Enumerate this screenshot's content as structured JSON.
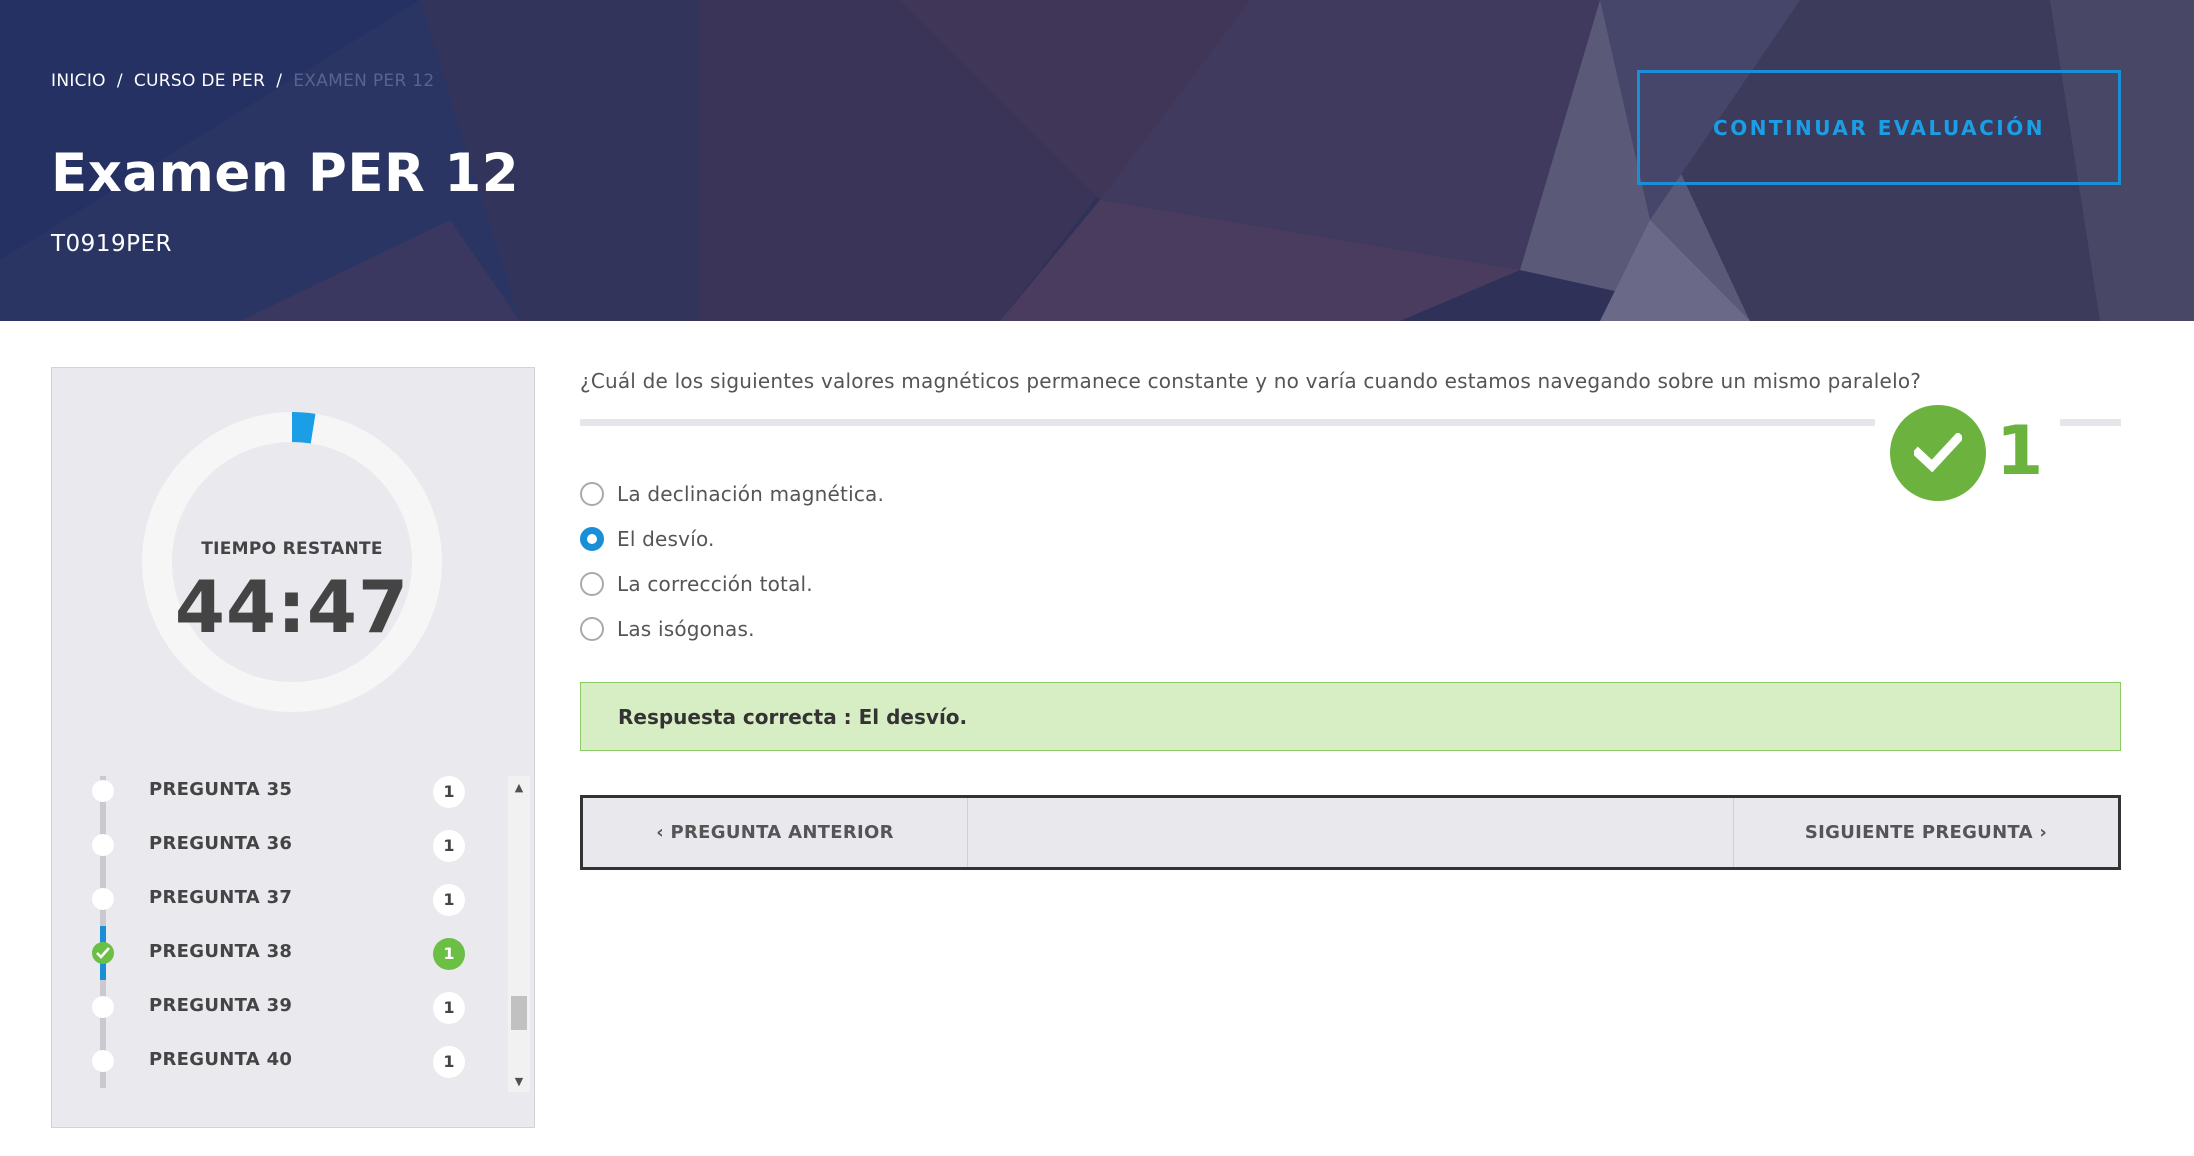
{
  "header": {
    "breadcrumb": [
      {
        "label": "INICIO"
      },
      {
        "label": "CURSO DE PER"
      },
      {
        "label": "EXAMEN PER 12"
      }
    ],
    "separator": "/",
    "title": "Examen PER 12",
    "code": "T0919PER",
    "continue_label": "CONTINUAR EVALUACIÓN"
  },
  "timer": {
    "label": "TIEMPO RESTANTE",
    "value": "44:47",
    "elapsed_fraction": 0.025
  },
  "question_list": [
    {
      "label": "PREGUNTA 35",
      "badge": "1",
      "status": "pending"
    },
    {
      "label": "PREGUNTA 36",
      "badge": "1",
      "status": "pending"
    },
    {
      "label": "PREGUNTA 37",
      "badge": "1",
      "status": "pending"
    },
    {
      "label": "PREGUNTA 38",
      "badge": "1",
      "status": "correct"
    },
    {
      "label": "PREGUNTA 39",
      "badge": "1",
      "status": "pending"
    },
    {
      "label": "PREGUNTA 40",
      "badge": "1",
      "status": "pending"
    }
  ],
  "question": {
    "text": "¿Cuál de los siguientes valores magnéticos permanece constante y no varía cuando estamos navegando sobre un mismo paralelo?",
    "options": [
      {
        "label": "La declinación magnética.",
        "selected": false
      },
      {
        "label": "El desvío.",
        "selected": true
      },
      {
        "label": "La corrección total.",
        "selected": false
      },
      {
        "label": "Las isógonas.",
        "selected": false
      }
    ],
    "score": "1",
    "feedback": "Respuesta correcta : El desvío."
  },
  "navigation": {
    "prev_label": "‹ PREGUNTA ANTERIOR",
    "next_label": "SIGUIENTE PREGUNTA ›"
  },
  "icons": {
    "check": "check-icon",
    "scroll_up": "arrow-up-icon",
    "scroll_down": "arrow-down-icon"
  },
  "colors": {
    "accent_blue": "#1a8ed6",
    "success_green": "#6bb33e",
    "feedback_bg": "#d7edc4",
    "hero_bg": "#2f3158"
  }
}
